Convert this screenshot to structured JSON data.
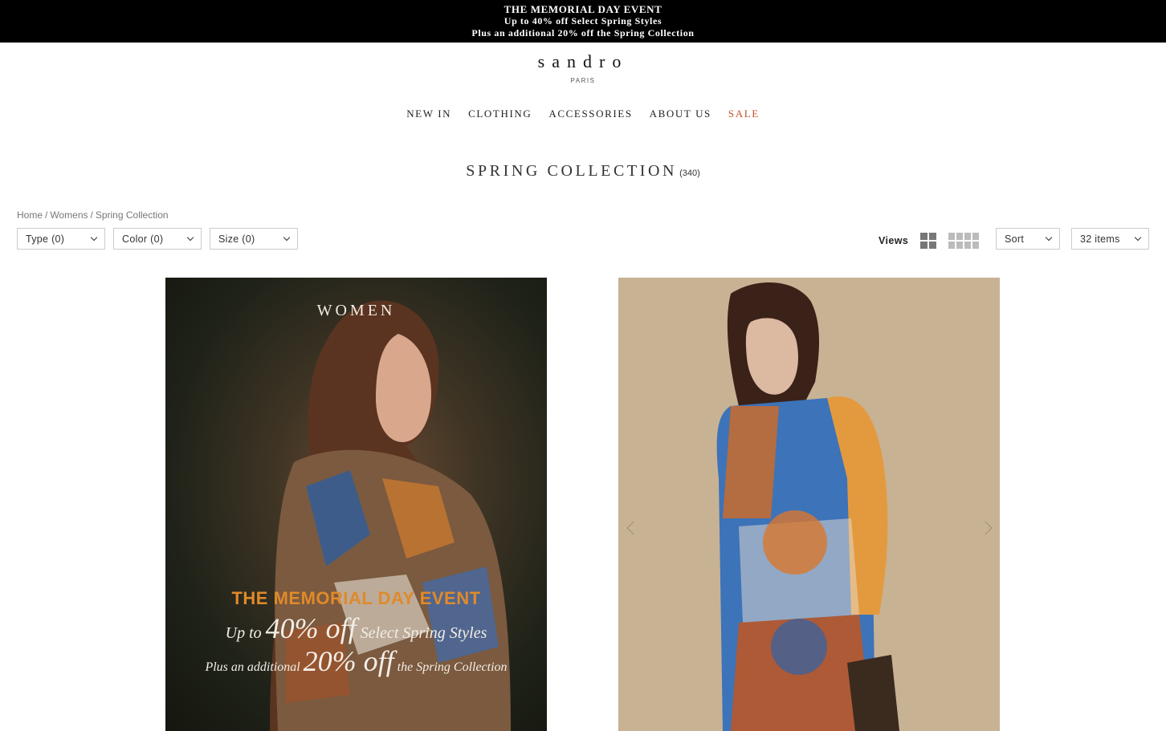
{
  "promo": {
    "line1": "THE MEMORIAL DAY EVENT",
    "line2": "Up to 40% off Select Spring Styles",
    "line3": "Plus an additional 20% off the Spring Collection"
  },
  "logo": {
    "brand": "sandro",
    "city": "PARIS"
  },
  "nav": {
    "new_in": "NEW IN",
    "clothing": "CLOTHING",
    "accessories": "ACCESSORIES",
    "about_us": "ABOUT US",
    "sale": "SALE"
  },
  "page": {
    "title": "SPRING COLLECTION",
    "count": "(340)"
  },
  "breadcrumb": {
    "home": "Home",
    "sep": "/",
    "womens": "Womens",
    "current": "Spring Collection"
  },
  "filters": {
    "type": "Type (0)",
    "color": "Color (0)",
    "size": "Size (0)"
  },
  "toolbar": {
    "views_label": "Views",
    "sort": "Sort",
    "items_per_page": "32 items"
  },
  "banner": {
    "label": "WOMEN",
    "headline": "THE MEMORIAL DAY EVENT",
    "l2_pre": "Up to ",
    "l2_big": "40% off",
    "l2_post": " Select Spring Styles",
    "l3_pre": "Plus an additional ",
    "l3_big": "20% off",
    "l3_post": " the Spring Collection"
  },
  "colors": {
    "sale": "#c4532c",
    "banner_orange": "#e08a2a",
    "promo_bg": "#000000"
  }
}
